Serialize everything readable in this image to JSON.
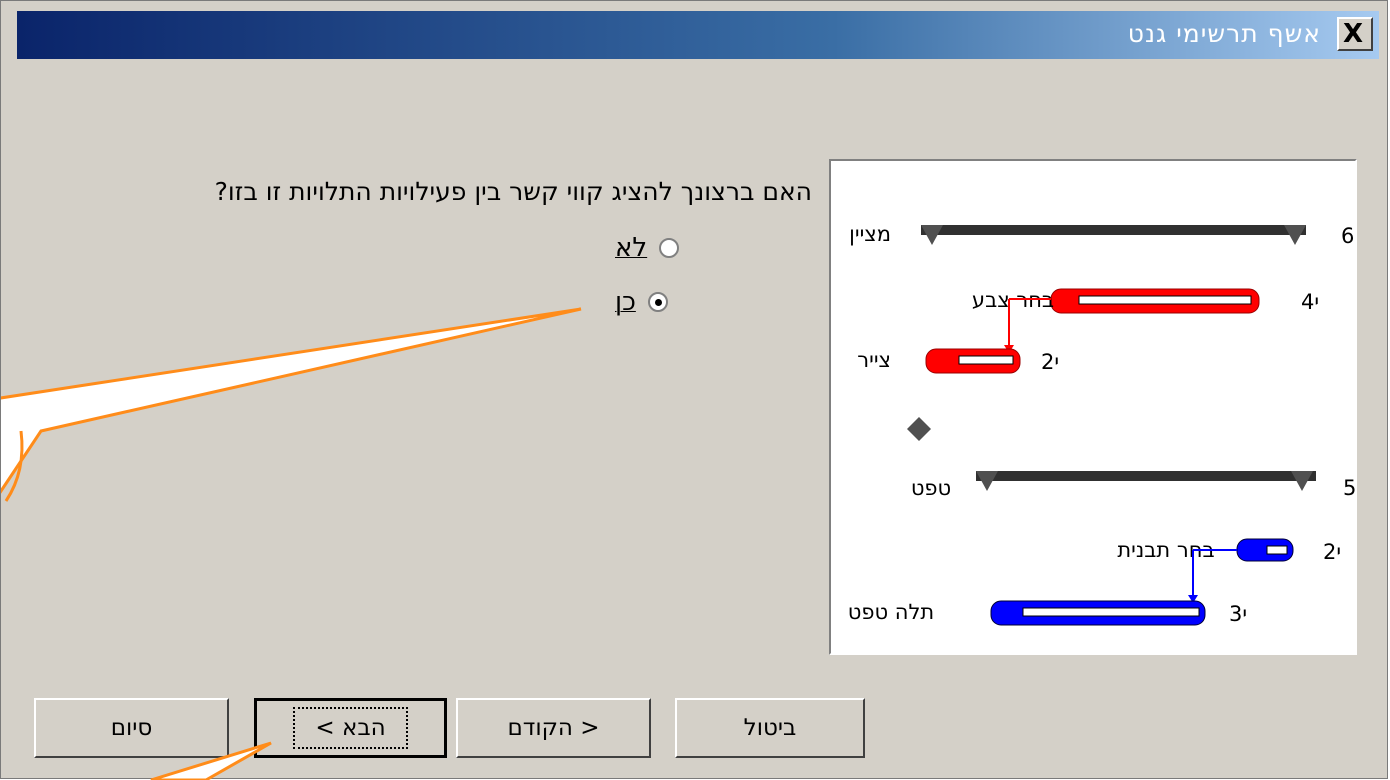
{
  "window": {
    "title": "אשף תרשימי גנט",
    "close_label": "X"
  },
  "question": "האם ברצונך להציג קווי קשר בין פעילויות התלויות זו בזו?",
  "options": [
    {
      "label": "לא",
      "selected": false
    },
    {
      "label": "כן",
      "selected": true
    }
  ],
  "preview": {
    "rows": [
      {
        "task": "מציין",
        "duration": "6י",
        "color": "#303030"
      },
      {
        "task": "בחר צבע",
        "duration": "4י",
        "color": "#ff0000"
      },
      {
        "task": "צייר",
        "duration": "2י",
        "color": "#ff0000"
      },
      {
        "task": "",
        "duration": "",
        "color": "#505050"
      },
      {
        "task": "טפט",
        "duration": "5י",
        "color": "#303030"
      },
      {
        "task": "בחר תבנית",
        "duration": "2י",
        "color": "#0000ff"
      },
      {
        "task": "תלה טפט",
        "duration": "3י",
        "color": "#0000ff"
      }
    ]
  },
  "buttons": {
    "cancel": "ביטול",
    "back": "< הקודם",
    "next": "הבא >",
    "finish": "סיום"
  },
  "colors": {
    "title_start": "#0a246a",
    "title_end": "#a6caf0",
    "callout": "#ff8c1a"
  }
}
